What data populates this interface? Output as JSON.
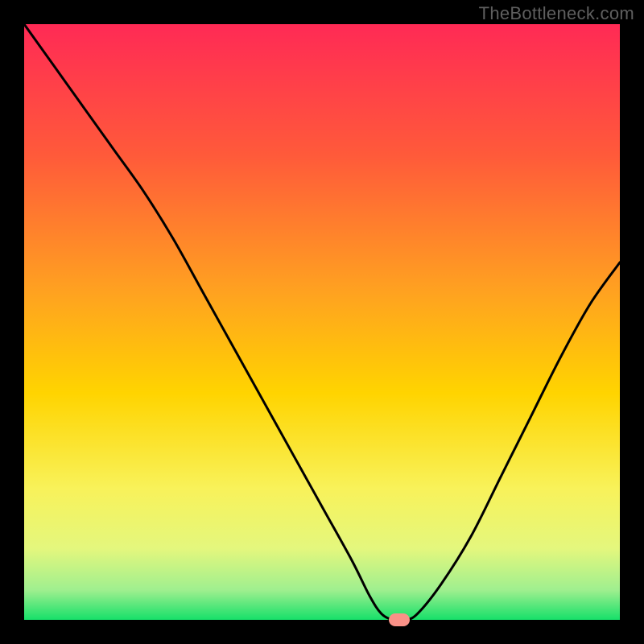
{
  "watermark": "TheBottleneck.com",
  "chart_data": {
    "type": "line",
    "title": "",
    "xlabel": "",
    "ylabel": "",
    "xlim": [
      0,
      100
    ],
    "ylim": [
      0,
      100
    ],
    "series": [
      {
        "name": "curve",
        "x": [
          0,
          5,
          10,
          15,
          20,
          25,
          30,
          35,
          40,
          45,
          50,
          55,
          58,
          60,
          62,
          64,
          66,
          70,
          75,
          80,
          85,
          90,
          95,
          100
        ],
        "y": [
          100,
          93,
          86,
          79,
          72,
          64,
          55,
          46,
          37,
          28,
          19,
          10,
          4,
          1,
          0,
          0,
          1,
          6,
          14,
          24,
          34,
          44,
          53,
          60
        ]
      }
    ],
    "marker": {
      "x": 63,
      "y": 0,
      "color": "#f99187"
    },
    "gradient_stops": [
      {
        "offset": 0,
        "color": "#ff2a55"
      },
      {
        "offset": 0.22,
        "color": "#ff5a3a"
      },
      {
        "offset": 0.45,
        "color": "#ffa220"
      },
      {
        "offset": 0.62,
        "color": "#ffd400"
      },
      {
        "offset": 0.78,
        "color": "#f8f25a"
      },
      {
        "offset": 0.88,
        "color": "#e4f77d"
      },
      {
        "offset": 0.95,
        "color": "#9fef8f"
      },
      {
        "offset": 1.0,
        "color": "#16e06a"
      }
    ]
  }
}
